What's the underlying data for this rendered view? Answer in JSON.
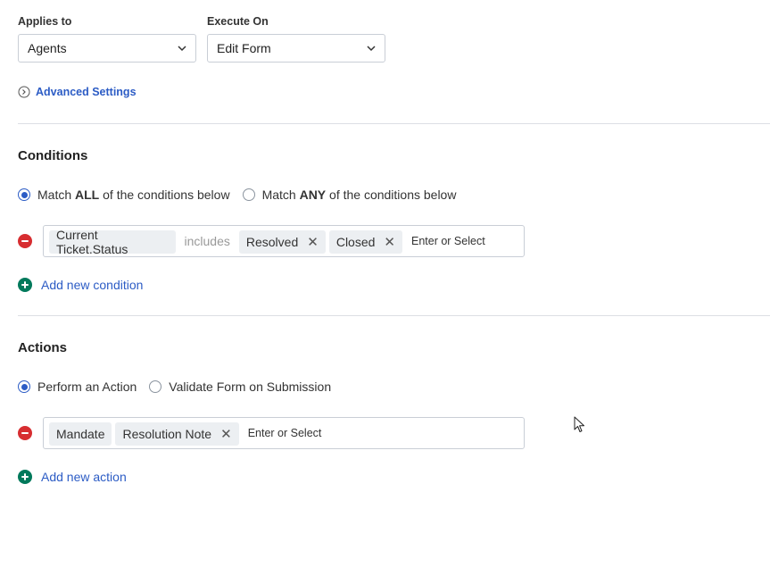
{
  "applies_to": {
    "label": "Applies to",
    "value": "Agents"
  },
  "execute_on": {
    "label": "Execute On",
    "value": "Edit Form"
  },
  "advanced_settings_label": "Advanced Settings",
  "conditions": {
    "title": "Conditions",
    "match_all_prefix": "Match ",
    "match_all_bold": "ALL",
    "match_all_suffix": " of the conditions below",
    "match_any_prefix": "Match ",
    "match_any_bold": "ANY",
    "match_any_suffix": " of the conditions below",
    "selected": "all",
    "rule": {
      "field": "Current Ticket.Status",
      "operator": "includes",
      "values": [
        "Resolved",
        "Closed"
      ],
      "placeholder": "Enter or Select"
    },
    "add_label": "Add new condition"
  },
  "actions": {
    "title": "Actions",
    "option_perform": "Perform an Action",
    "option_validate": "Validate Form on Submission",
    "selected": "perform",
    "rule": {
      "action": "Mandate",
      "values": [
        "Resolution Note"
      ],
      "placeholder": "Enter or Select"
    },
    "add_label": "Add new action"
  },
  "icons": {
    "chevron": "chevron-down-icon",
    "advanced": "chevron-right-circle-icon",
    "remove": "minus-circle-icon",
    "add": "plus-circle-icon",
    "cursor": "mouse-pointer-icon"
  },
  "colors": {
    "accent": "#2c5cc5",
    "remove": "#d72d30",
    "add": "#00795b"
  }
}
